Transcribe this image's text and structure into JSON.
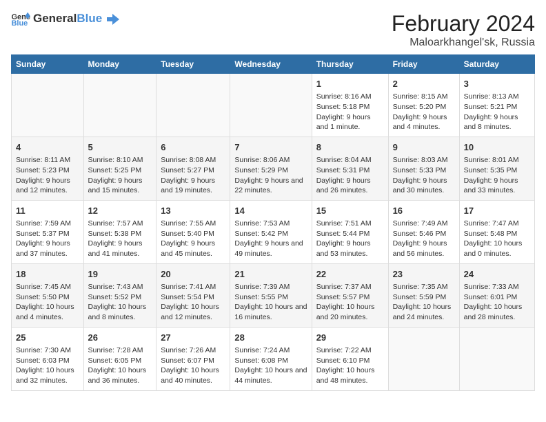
{
  "logo": {
    "text_general": "General",
    "text_blue": "Blue"
  },
  "title": "February 2024",
  "subtitle": "Maloarkhangel'sk, Russia",
  "days_of_week": [
    "Sunday",
    "Monday",
    "Tuesday",
    "Wednesday",
    "Thursday",
    "Friday",
    "Saturday"
  ],
  "weeks": [
    [
      {
        "num": "",
        "info": ""
      },
      {
        "num": "",
        "info": ""
      },
      {
        "num": "",
        "info": ""
      },
      {
        "num": "",
        "info": ""
      },
      {
        "num": "1",
        "info": "Sunrise: 8:16 AM\nSunset: 5:18 PM\nDaylight: 9 hours and 1 minute."
      },
      {
        "num": "2",
        "info": "Sunrise: 8:15 AM\nSunset: 5:20 PM\nDaylight: 9 hours and 4 minutes."
      },
      {
        "num": "3",
        "info": "Sunrise: 8:13 AM\nSunset: 5:21 PM\nDaylight: 9 hours and 8 minutes."
      }
    ],
    [
      {
        "num": "4",
        "info": "Sunrise: 8:11 AM\nSunset: 5:23 PM\nDaylight: 9 hours and 12 minutes."
      },
      {
        "num": "5",
        "info": "Sunrise: 8:10 AM\nSunset: 5:25 PM\nDaylight: 9 hours and 15 minutes."
      },
      {
        "num": "6",
        "info": "Sunrise: 8:08 AM\nSunset: 5:27 PM\nDaylight: 9 hours and 19 minutes."
      },
      {
        "num": "7",
        "info": "Sunrise: 8:06 AM\nSunset: 5:29 PM\nDaylight: 9 hours and 22 minutes."
      },
      {
        "num": "8",
        "info": "Sunrise: 8:04 AM\nSunset: 5:31 PM\nDaylight: 9 hours and 26 minutes."
      },
      {
        "num": "9",
        "info": "Sunrise: 8:03 AM\nSunset: 5:33 PM\nDaylight: 9 hours and 30 minutes."
      },
      {
        "num": "10",
        "info": "Sunrise: 8:01 AM\nSunset: 5:35 PM\nDaylight: 9 hours and 33 minutes."
      }
    ],
    [
      {
        "num": "11",
        "info": "Sunrise: 7:59 AM\nSunset: 5:37 PM\nDaylight: 9 hours and 37 minutes."
      },
      {
        "num": "12",
        "info": "Sunrise: 7:57 AM\nSunset: 5:38 PM\nDaylight: 9 hours and 41 minutes."
      },
      {
        "num": "13",
        "info": "Sunrise: 7:55 AM\nSunset: 5:40 PM\nDaylight: 9 hours and 45 minutes."
      },
      {
        "num": "14",
        "info": "Sunrise: 7:53 AM\nSunset: 5:42 PM\nDaylight: 9 hours and 49 minutes."
      },
      {
        "num": "15",
        "info": "Sunrise: 7:51 AM\nSunset: 5:44 PM\nDaylight: 9 hours and 53 minutes."
      },
      {
        "num": "16",
        "info": "Sunrise: 7:49 AM\nSunset: 5:46 PM\nDaylight: 9 hours and 56 minutes."
      },
      {
        "num": "17",
        "info": "Sunrise: 7:47 AM\nSunset: 5:48 PM\nDaylight: 10 hours and 0 minutes."
      }
    ],
    [
      {
        "num": "18",
        "info": "Sunrise: 7:45 AM\nSunset: 5:50 PM\nDaylight: 10 hours and 4 minutes."
      },
      {
        "num": "19",
        "info": "Sunrise: 7:43 AM\nSunset: 5:52 PM\nDaylight: 10 hours and 8 minutes."
      },
      {
        "num": "20",
        "info": "Sunrise: 7:41 AM\nSunset: 5:54 PM\nDaylight: 10 hours and 12 minutes."
      },
      {
        "num": "21",
        "info": "Sunrise: 7:39 AM\nSunset: 5:55 PM\nDaylight: 10 hours and 16 minutes."
      },
      {
        "num": "22",
        "info": "Sunrise: 7:37 AM\nSunset: 5:57 PM\nDaylight: 10 hours and 20 minutes."
      },
      {
        "num": "23",
        "info": "Sunrise: 7:35 AM\nSunset: 5:59 PM\nDaylight: 10 hours and 24 minutes."
      },
      {
        "num": "24",
        "info": "Sunrise: 7:33 AM\nSunset: 6:01 PM\nDaylight: 10 hours and 28 minutes."
      }
    ],
    [
      {
        "num": "25",
        "info": "Sunrise: 7:30 AM\nSunset: 6:03 PM\nDaylight: 10 hours and 32 minutes."
      },
      {
        "num": "26",
        "info": "Sunrise: 7:28 AM\nSunset: 6:05 PM\nDaylight: 10 hours and 36 minutes."
      },
      {
        "num": "27",
        "info": "Sunrise: 7:26 AM\nSunset: 6:07 PM\nDaylight: 10 hours and 40 minutes."
      },
      {
        "num": "28",
        "info": "Sunrise: 7:24 AM\nSunset: 6:08 PM\nDaylight: 10 hours and 44 minutes."
      },
      {
        "num": "29",
        "info": "Sunrise: 7:22 AM\nSunset: 6:10 PM\nDaylight: 10 hours and 48 minutes."
      },
      {
        "num": "",
        "info": ""
      },
      {
        "num": "",
        "info": ""
      }
    ]
  ]
}
